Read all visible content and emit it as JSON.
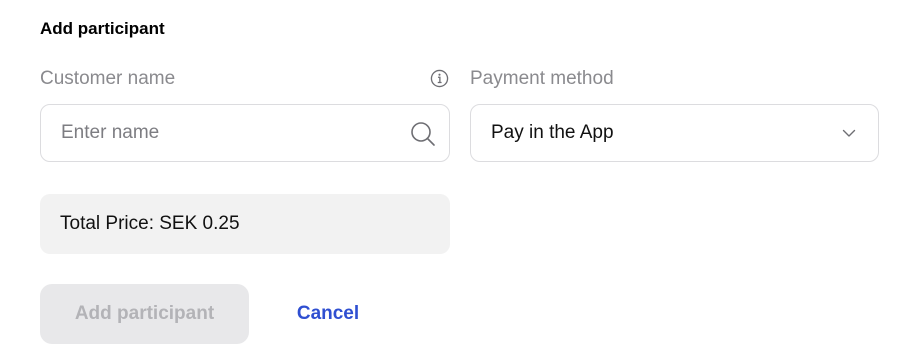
{
  "form": {
    "title": "Add participant",
    "customer_name": {
      "label": "Customer name",
      "placeholder": "Enter name",
      "value": ""
    },
    "payment_method": {
      "label": "Payment method",
      "selected": "Pay in the App"
    },
    "total_price": "Total Price: SEK 0.25",
    "actions": {
      "submit_label": "Add participant",
      "cancel_label": "Cancel"
    }
  },
  "icons": {
    "info": "info-icon",
    "search": "search-icon",
    "dropdown": "chevron-down-icon"
  },
  "colors": {
    "accent": "#2f4fd1",
    "label": "#8a8a8e",
    "disabled_button_bg": "#e8e8ea",
    "disabled_button_text": "#b3b3b7",
    "price_bg": "#f2f2f2"
  }
}
